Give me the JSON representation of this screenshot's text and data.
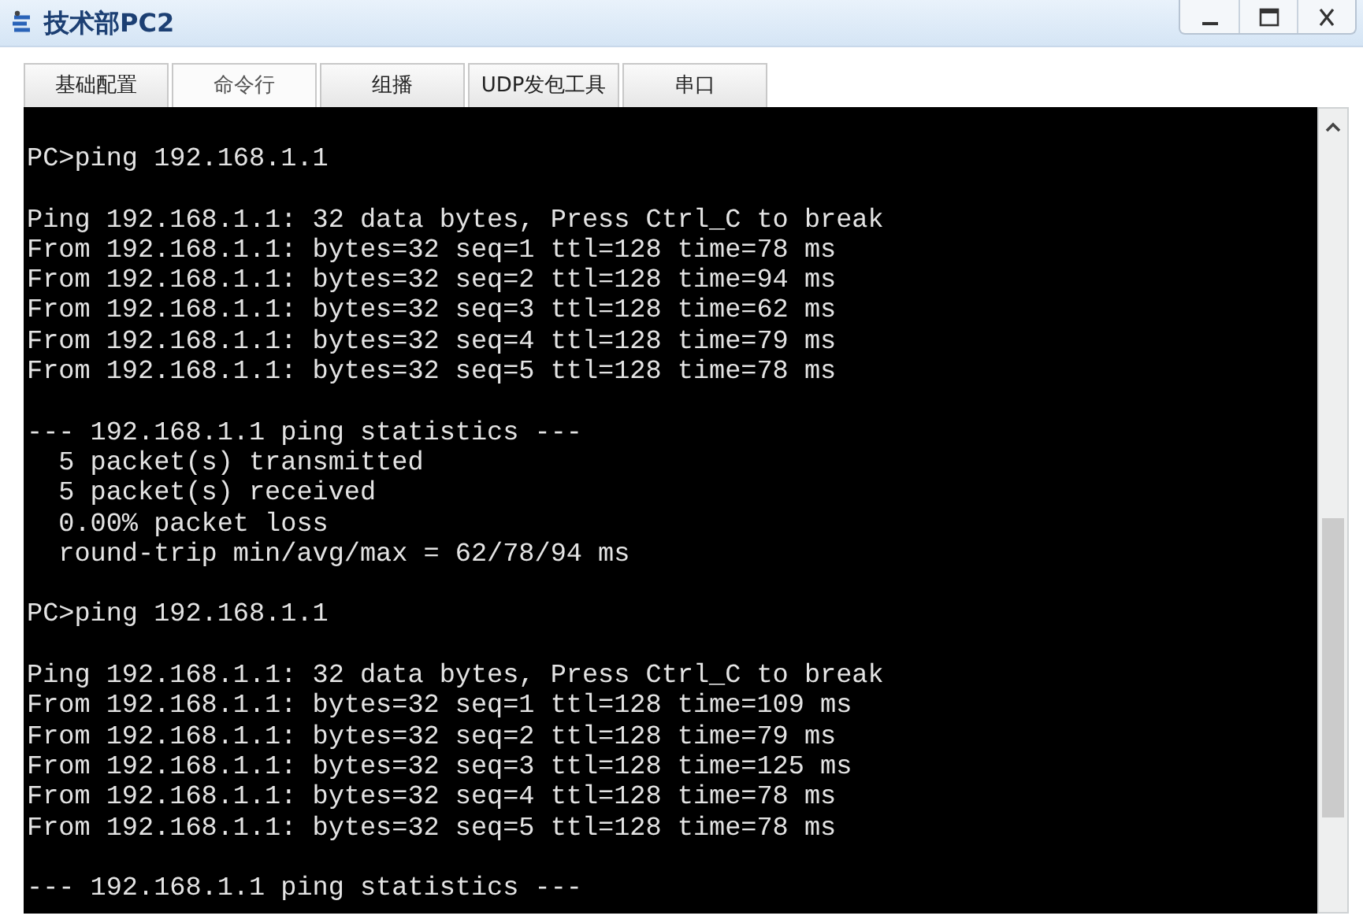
{
  "window": {
    "title": "技术部PC2"
  },
  "tabs": [
    {
      "label": "基础配置",
      "selected": false
    },
    {
      "label": "命令行",
      "selected": true
    },
    {
      "label": "组播",
      "selected": false
    },
    {
      "label": "UDP发包工具",
      "selected": false
    },
    {
      "label": "串口",
      "selected": false
    }
  ],
  "terminal": {
    "blocks": [
      [
        "PC>ping 192.168.1.1"
      ],
      [
        "Ping 192.168.1.1: 32 data bytes, Press Ctrl_C to break",
        "From 192.168.1.1: bytes=32 seq=1 ttl=128 time=78 ms",
        "From 192.168.1.1: bytes=32 seq=2 ttl=128 time=94 ms",
        "From 192.168.1.1: bytes=32 seq=3 ttl=128 time=62 ms",
        "From 192.168.1.1: bytes=32 seq=4 ttl=128 time=79 ms",
        "From 192.168.1.1: bytes=32 seq=5 ttl=128 time=78 ms"
      ],
      [
        "--- 192.168.1.1 ping statistics ---",
        "  5 packet(s) transmitted",
        "  5 packet(s) received",
        "  0.00% packet loss",
        "  round-trip min/avg/max = 62/78/94 ms"
      ],
      [
        "PC>ping 192.168.1.1"
      ],
      [
        "Ping 192.168.1.1: 32 data bytes, Press Ctrl_C to break",
        "From 192.168.1.1: bytes=32 seq=1 ttl=128 time=109 ms",
        "From 192.168.1.1: bytes=32 seq=2 ttl=128 time=79 ms",
        "From 192.168.1.1: bytes=32 seq=3 ttl=128 time=125 ms",
        "From 192.168.1.1: bytes=32 seq=4 ttl=128 time=78 ms",
        "From 192.168.1.1: bytes=32 seq=5 ttl=128 time=78 ms"
      ],
      [
        "--- 192.168.1.1 ping statistics ---"
      ]
    ]
  }
}
